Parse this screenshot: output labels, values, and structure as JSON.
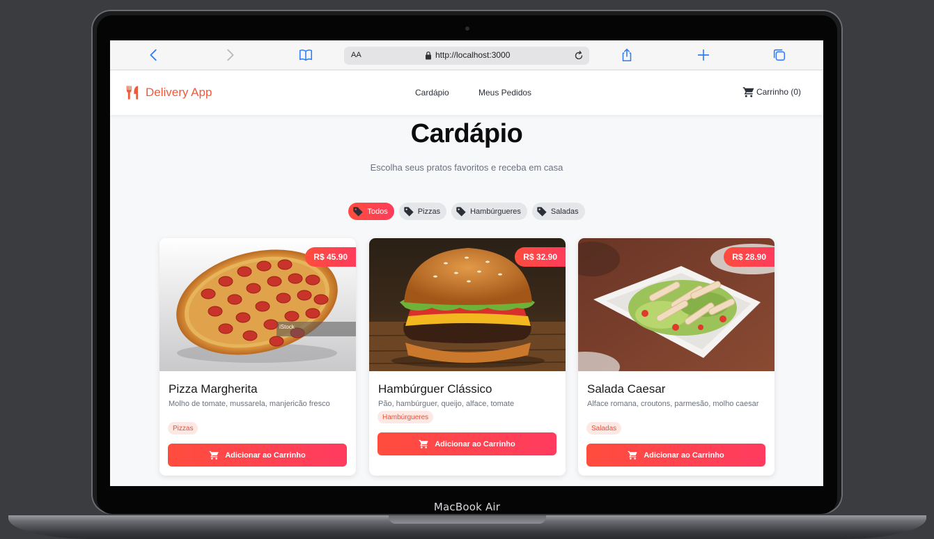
{
  "device": {
    "label": "MacBook Air"
  },
  "browser": {
    "text_size_label": "AA",
    "url": "http://localhost:3000"
  },
  "app": {
    "brand": "Delivery App",
    "nav": {
      "menu": "Cardápio",
      "orders": "Meus Pedidos",
      "cart": "Carrinho (0)"
    },
    "page_title": "Cardápio",
    "page_subtitle": "Escolha seus pratos favoritos e receba em casa",
    "filters": [
      {
        "label": "Todos",
        "active": true
      },
      {
        "label": "Pizzas",
        "active": false
      },
      {
        "label": "Hambúrgueres",
        "active": false
      },
      {
        "label": "Saladas",
        "active": false
      }
    ],
    "products": [
      {
        "price": "R$ 45.90",
        "name": "Pizza Margherita",
        "description": "Molho de tomate, mussarela, manjericão fresco",
        "category": "Pizzas",
        "button": "Adicionar ao Carrinho",
        "image_caption": "iStock"
      },
      {
        "price": "R$ 32.90",
        "name": "Hambúrguer Clássico",
        "description": "Pão, hambúrguer, queijo, alface, tomate",
        "category": "Hambúrgueres",
        "button": "Adicionar ao Carrinho"
      },
      {
        "price": "R$ 28.90",
        "name": "Salada Caesar",
        "description": "Alface romana, croutons, parmesão, molho caesar",
        "category": "Saladas",
        "button": "Adicionar ao Carrinho"
      }
    ]
  },
  "colors": {
    "accent": "#ff4d3d",
    "brand": "#f05a3a",
    "safari_blue": "#2f7cf6"
  }
}
